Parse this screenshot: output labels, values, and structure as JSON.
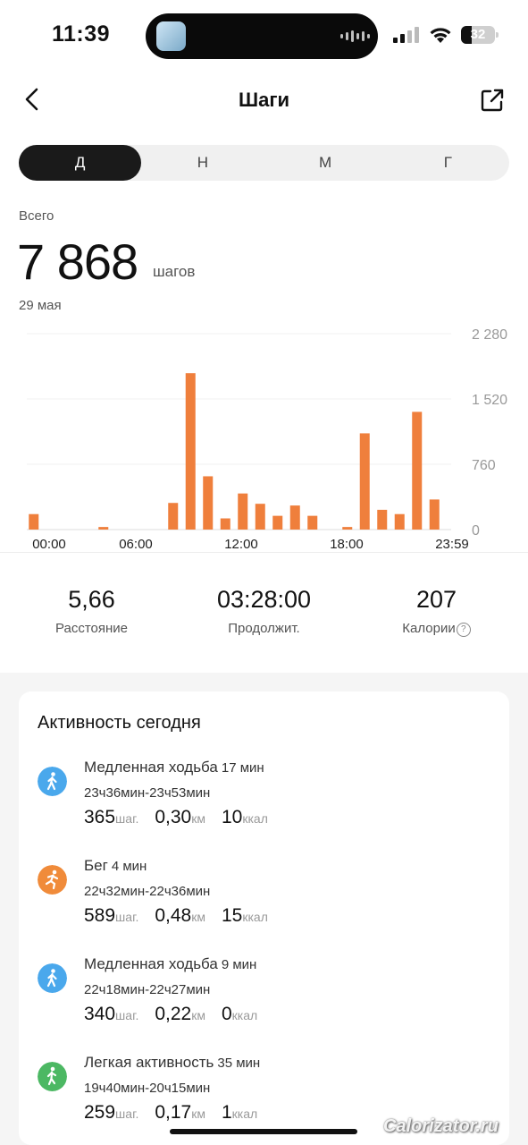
{
  "status": {
    "time": "11:39",
    "battery": "32"
  },
  "header": {
    "title": "Шаги"
  },
  "segments": [
    "Д",
    "Н",
    "М",
    "Г"
  ],
  "summary": {
    "label": "Всего",
    "value": "7 868",
    "unit": "шагов",
    "date": "29 мая"
  },
  "chart_data": {
    "type": "bar",
    "y_ticks": [
      "2 280",
      "1 520",
      "760",
      "0"
    ],
    "x_ticks": [
      "00:00",
      "06:00",
      "12:00",
      "18:00",
      "23:59"
    ],
    "ylim": [
      0,
      2280
    ],
    "x": [
      0,
      1,
      2,
      3,
      4,
      5,
      6,
      7,
      8,
      9,
      10,
      11,
      12,
      13,
      14,
      15,
      16,
      17,
      18,
      19,
      20,
      21,
      22,
      23
    ],
    "values": [
      180,
      0,
      0,
      0,
      30,
      0,
      0,
      0,
      310,
      1820,
      620,
      130,
      420,
      300,
      160,
      280,
      160,
      0,
      30,
      1120,
      230,
      180,
      1370,
      350
    ],
    "color": "#ef7f3c"
  },
  "stats": [
    {
      "value": "5,66",
      "label": "Расстояние"
    },
    {
      "value": "03:28:00",
      "label": "Продолжит."
    },
    {
      "value": "207",
      "label": "Калории"
    }
  ],
  "activity": {
    "title": "Активность сегодня",
    "items": [
      {
        "icon": "walking-icon",
        "color": "#4aa8ec",
        "name": "Медленная ходьба",
        "duration": "17 мин",
        "range": "23ч36мин-23ч53мин",
        "steps": "365",
        "steps_unit": "шаг.",
        "distance": "0,30",
        "distance_unit": "км",
        "kcal": "10",
        "kcal_unit": "ккал"
      },
      {
        "icon": "running-icon",
        "color": "#f08b3a",
        "name": "Бег",
        "duration": "4 мин",
        "range": "22ч32мин-22ч36мин",
        "steps": "589",
        "steps_unit": "шаг.",
        "distance": "0,48",
        "distance_unit": "км",
        "kcal": "15",
        "kcal_unit": "ккал"
      },
      {
        "icon": "walking-icon",
        "color": "#4aa8ec",
        "name": "Медленная ходьба",
        "duration": "9 мин",
        "range": "22ч18мин-22ч27мин",
        "steps": "340",
        "steps_unit": "шаг.",
        "distance": "0,22",
        "distance_unit": "км",
        "kcal": "0",
        "kcal_unit": "ккал"
      },
      {
        "icon": "light-activity-icon",
        "color": "#4cb863",
        "name": "Легкая активность",
        "duration": "35 мин",
        "range": "19ч40мин-20ч15мин",
        "steps": "259",
        "steps_unit": "шаг.",
        "distance": "0,17",
        "distance_unit": "км",
        "kcal": "1",
        "kcal_unit": "ккал"
      }
    ]
  },
  "watermark": "Calorizator.ru"
}
